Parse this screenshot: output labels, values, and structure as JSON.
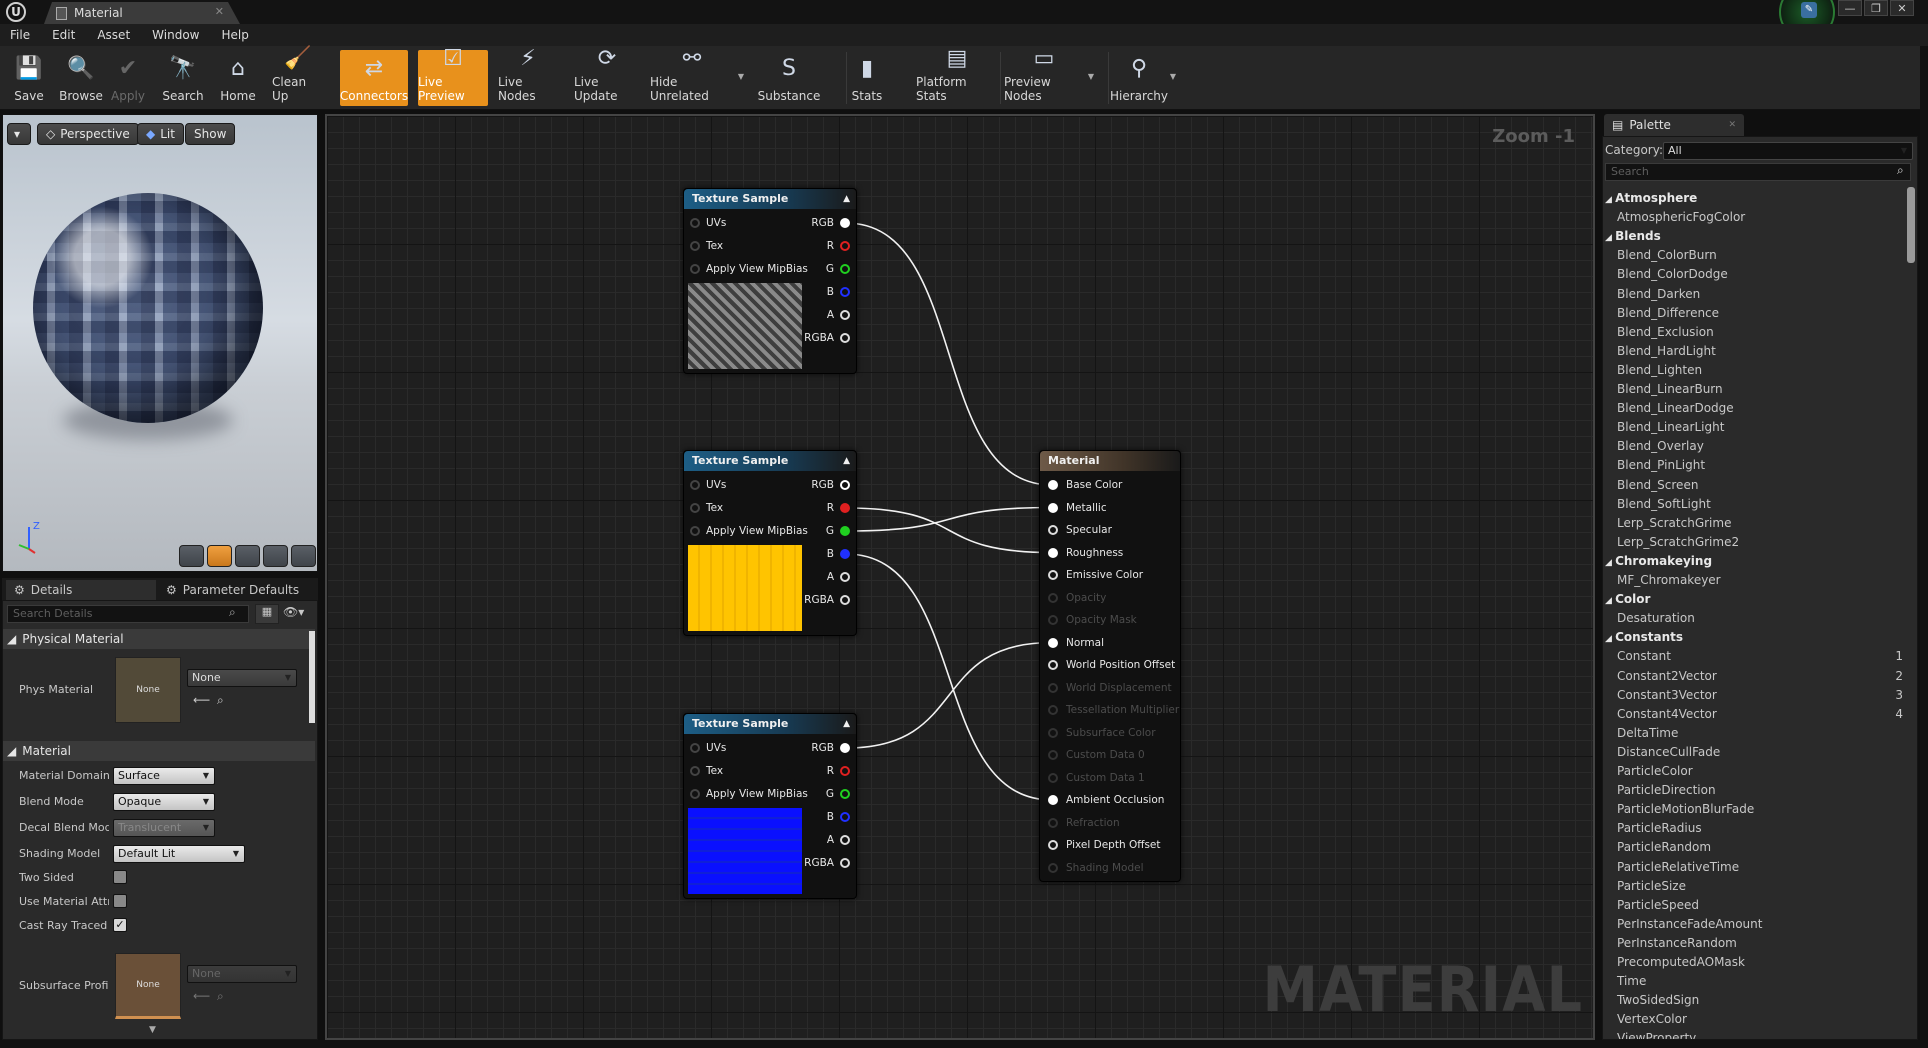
{
  "window": {
    "tab_title": "Material",
    "win_buttons": [
      "—",
      "❐",
      "✕"
    ]
  },
  "menu": [
    "File",
    "Edit",
    "Asset",
    "Window",
    "Help"
  ],
  "toolbar": [
    {
      "label": "Save",
      "icon": "save-icon",
      "glyph": "💾"
    },
    {
      "label": "Browse",
      "icon": "browse-icon",
      "glyph": "🔍"
    },
    {
      "label": "Apply",
      "icon": "apply-icon",
      "glyph": "✔"
    },
    {
      "label": "Search",
      "icon": "search-icon",
      "glyph": "🔭"
    },
    {
      "label": "Home",
      "icon": "home-icon",
      "glyph": "⌂"
    },
    {
      "label": "Clean Up",
      "icon": "clean-up-icon",
      "glyph": "🧹"
    },
    {
      "label": "Connectors",
      "icon": "connectors-icon",
      "glyph": "⇄"
    },
    {
      "label": "Live Preview",
      "icon": "live-preview-icon",
      "glyph": "☑"
    },
    {
      "label": "Live Nodes",
      "icon": "live-nodes-icon",
      "glyph": "⚡"
    },
    {
      "label": "Live Update",
      "icon": "live-update-icon",
      "glyph": "⟳"
    },
    {
      "label": "Hide Unrelated",
      "icon": "hide-unrelated-icon",
      "glyph": "⚯"
    },
    {
      "label": "Substance",
      "icon": "substance-icon",
      "glyph": "S"
    },
    {
      "label": "Stats",
      "icon": "stats-icon",
      "glyph": "▮"
    },
    {
      "label": "Platform Stats",
      "icon": "platform-stats-icon",
      "glyph": "▤"
    },
    {
      "label": "Preview Nodes",
      "icon": "preview-nodes-icon",
      "glyph": "▭"
    },
    {
      "label": "Hierarchy",
      "icon": "hierarchy-icon",
      "glyph": "⚲"
    }
  ],
  "viewport": {
    "perspective": "Perspective",
    "lit": "Lit",
    "show": "Show",
    "axis_z": "Z"
  },
  "details": {
    "tab_details": "Details",
    "tab_params": "Parameter Defaults",
    "search_placeholder": "Search Details",
    "physical_material_cat": "Physical Material",
    "phys_material_label": "Phys Material",
    "phys_thumb": "None",
    "phys_value": "None",
    "material_cat": "Material",
    "props": [
      {
        "label": "Material Domain",
        "value": "Surface"
      },
      {
        "label": "Blend Mode",
        "value": "Opaque"
      },
      {
        "label": "Decal Blend Mode",
        "value": "Translucent"
      },
      {
        "label": "Shading Model",
        "value": "Default Lit"
      }
    ],
    "checks": [
      {
        "label": "Two Sided",
        "checked": false
      },
      {
        "label": "Use Material Attributes",
        "checked": false
      },
      {
        "label": "Cast Ray Traced Shadows",
        "checked": true
      }
    ],
    "subsurface_label": "Subsurface Profile",
    "subsurface_thumb": "None",
    "subsurface_value": "None"
  },
  "graph": {
    "zoom": "Zoom -1",
    "watermark": "MATERIAL",
    "texture_nodes": [
      {
        "title": "Texture Sample",
        "preview": "gray"
      },
      {
        "title": "Texture Sample",
        "preview": "yellow"
      },
      {
        "title": "Texture Sample",
        "preview": "blue"
      }
    ],
    "tex_inputs": [
      "UVs",
      "Tex",
      "Apply View MipBias"
    ],
    "tex_outputs": [
      "RGB",
      "R",
      "G",
      "B",
      "A",
      "RGBA"
    ],
    "material_node": {
      "title": "Material",
      "pins": [
        {
          "label": "Base Color",
          "active": true,
          "connected": true
        },
        {
          "label": "Metallic",
          "active": true,
          "connected": true
        },
        {
          "label": "Specular",
          "active": true,
          "connected": false
        },
        {
          "label": "Roughness",
          "active": true,
          "connected": true
        },
        {
          "label": "Emissive Color",
          "active": true,
          "connected": false
        },
        {
          "label": "Opacity",
          "active": false
        },
        {
          "label": "Opacity Mask",
          "active": false
        },
        {
          "label": "Normal",
          "active": true,
          "connected": true
        },
        {
          "label": "World Position Offset",
          "active": true,
          "connected": false
        },
        {
          "label": "World Displacement",
          "active": false
        },
        {
          "label": "Tessellation Multiplier",
          "active": false
        },
        {
          "label": "Subsurface Color",
          "active": false
        },
        {
          "label": "Custom Data 0",
          "active": false
        },
        {
          "label": "Custom Data 1",
          "active": false
        },
        {
          "label": "Ambient Occlusion",
          "active": true,
          "connected": true
        },
        {
          "label": "Refraction",
          "active": false
        },
        {
          "label": "Pixel Depth Offset",
          "active": true,
          "connected": false
        },
        {
          "label": "Shading Model",
          "active": false
        }
      ]
    }
  },
  "palette": {
    "tab": "Palette",
    "category_label": "Category:",
    "category_value": "All",
    "search_placeholder": "Search",
    "items": [
      {
        "t": "cat",
        "label": "Atmosphere"
      },
      {
        "t": "item",
        "label": "AtmosphericFogColor"
      },
      {
        "t": "cat",
        "label": "Blends"
      },
      {
        "t": "item",
        "label": "Blend_ColorBurn"
      },
      {
        "t": "item",
        "label": "Blend_ColorDodge"
      },
      {
        "t": "item",
        "label": "Blend_Darken"
      },
      {
        "t": "item",
        "label": "Blend_Difference"
      },
      {
        "t": "item",
        "label": "Blend_Exclusion"
      },
      {
        "t": "item",
        "label": "Blend_HardLight"
      },
      {
        "t": "item",
        "label": "Blend_Lighten"
      },
      {
        "t": "item",
        "label": "Blend_LinearBurn"
      },
      {
        "t": "item",
        "label": "Blend_LinearDodge"
      },
      {
        "t": "item",
        "label": "Blend_LinearLight"
      },
      {
        "t": "item",
        "label": "Blend_Overlay"
      },
      {
        "t": "item",
        "label": "Blend_PinLight"
      },
      {
        "t": "item",
        "label": "Blend_Screen"
      },
      {
        "t": "item",
        "label": "Blend_SoftLight"
      },
      {
        "t": "item",
        "label": "Lerp_ScratchGrime"
      },
      {
        "t": "item",
        "label": "Lerp_ScratchGrime2"
      },
      {
        "t": "cat",
        "label": "Chromakeying"
      },
      {
        "t": "item",
        "label": "MF_Chromakeyer"
      },
      {
        "t": "cat",
        "label": "Color"
      },
      {
        "t": "item",
        "label": "Desaturation"
      },
      {
        "t": "cat",
        "label": "Constants"
      },
      {
        "t": "item",
        "label": "Constant",
        "hotkey": "1"
      },
      {
        "t": "item",
        "label": "Constant2Vector",
        "hotkey": "2"
      },
      {
        "t": "item",
        "label": "Constant3Vector",
        "hotkey": "3"
      },
      {
        "t": "item",
        "label": "Constant4Vector",
        "hotkey": "4"
      },
      {
        "t": "item",
        "label": "DeltaTime"
      },
      {
        "t": "item",
        "label": "DistanceCullFade"
      },
      {
        "t": "item",
        "label": "ParticleColor"
      },
      {
        "t": "item",
        "label": "ParticleDirection"
      },
      {
        "t": "item",
        "label": "ParticleMotionBlurFade"
      },
      {
        "t": "item",
        "label": "ParticleRadius"
      },
      {
        "t": "item",
        "label": "ParticleRandom"
      },
      {
        "t": "item",
        "label": "ParticleRelativeTime"
      },
      {
        "t": "item",
        "label": "ParticleSize"
      },
      {
        "t": "item",
        "label": "ParticleSpeed"
      },
      {
        "t": "item",
        "label": "PerInstanceFadeAmount"
      },
      {
        "t": "item",
        "label": "PerInstanceRandom"
      },
      {
        "t": "item",
        "label": "PrecomputedAOMask"
      },
      {
        "t": "item",
        "label": "Time"
      },
      {
        "t": "item",
        "label": "TwoSidedSign"
      },
      {
        "t": "item",
        "label": "VertexColor"
      },
      {
        "t": "item",
        "label": "ViewProperty"
      }
    ]
  },
  "colors": {
    "accent": "#e8911c",
    "pin_r": "#e02020",
    "pin_g": "#20d020",
    "pin_b": "#2030ff",
    "yellow": "#ffc400",
    "blue": "#0a10ff"
  }
}
